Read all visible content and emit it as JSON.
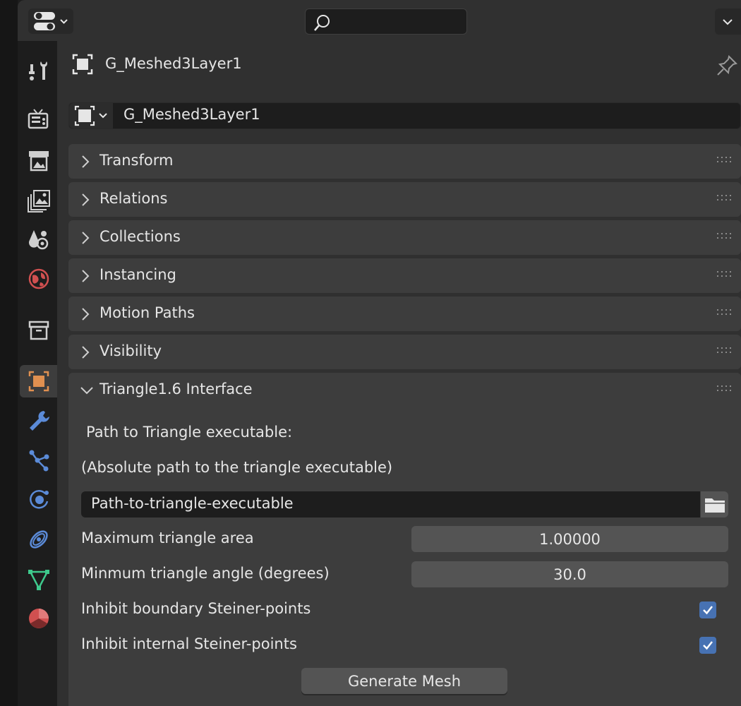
{
  "header": {
    "editor_type_icon": "properties-editor-icon",
    "search_placeholder": "",
    "options_icon": "chevron-down-icon"
  },
  "tabs": [
    {
      "icon": "tool-icon",
      "active": false
    },
    {
      "icon": "render-icon",
      "active": false
    },
    {
      "icon": "output-icon",
      "active": false
    },
    {
      "icon": "view-layer-icon",
      "active": false
    },
    {
      "icon": "scene-icon",
      "active": false
    },
    {
      "icon": "world-icon",
      "active": false
    },
    {
      "icon": "collection-icon",
      "active": false
    },
    {
      "icon": "object-icon",
      "active": true
    },
    {
      "icon": "modifier-wrench-icon",
      "active": false
    },
    {
      "icon": "particles-icon",
      "active": false
    },
    {
      "icon": "physics-icon",
      "active": false
    },
    {
      "icon": "constraints-icon",
      "active": false
    },
    {
      "icon": "object-data-icon",
      "active": false
    },
    {
      "icon": "material-icon",
      "active": false
    }
  ],
  "context": {
    "title": "G_Meshed3Layer1",
    "object_name": "G_Meshed3Layer1"
  },
  "panels": {
    "transform": "Transform",
    "relations": "Relations",
    "collections": "Collections",
    "instancing": "Instancing",
    "motion_paths": "Motion Paths",
    "visibility": "Visibility",
    "triangle": "Triangle1.6 Interface"
  },
  "triangle": {
    "path_label": "Path to Triangle executable:",
    "path_hint": "(Absolute path to the triangle executable)",
    "path_value": "Path-to-triangle-executable",
    "max_area_label": "Maximum triangle area",
    "max_area_value": "1.00000",
    "min_angle_label": "Minmum triangle angle (degrees)",
    "min_angle_value": "30.0",
    "inhibit_boundary_label": "Inhibit boundary Steiner-points",
    "inhibit_boundary_checked": true,
    "inhibit_internal_label": "Inhibit internal Steiner-points",
    "inhibit_internal_checked": true,
    "generate_label": "Generate Mesh"
  },
  "colors": {
    "accent": "#4772b3",
    "active_tab_orange": "#e09050",
    "panel_bg": "#303030",
    "panel_header": "#3d3d3d"
  }
}
